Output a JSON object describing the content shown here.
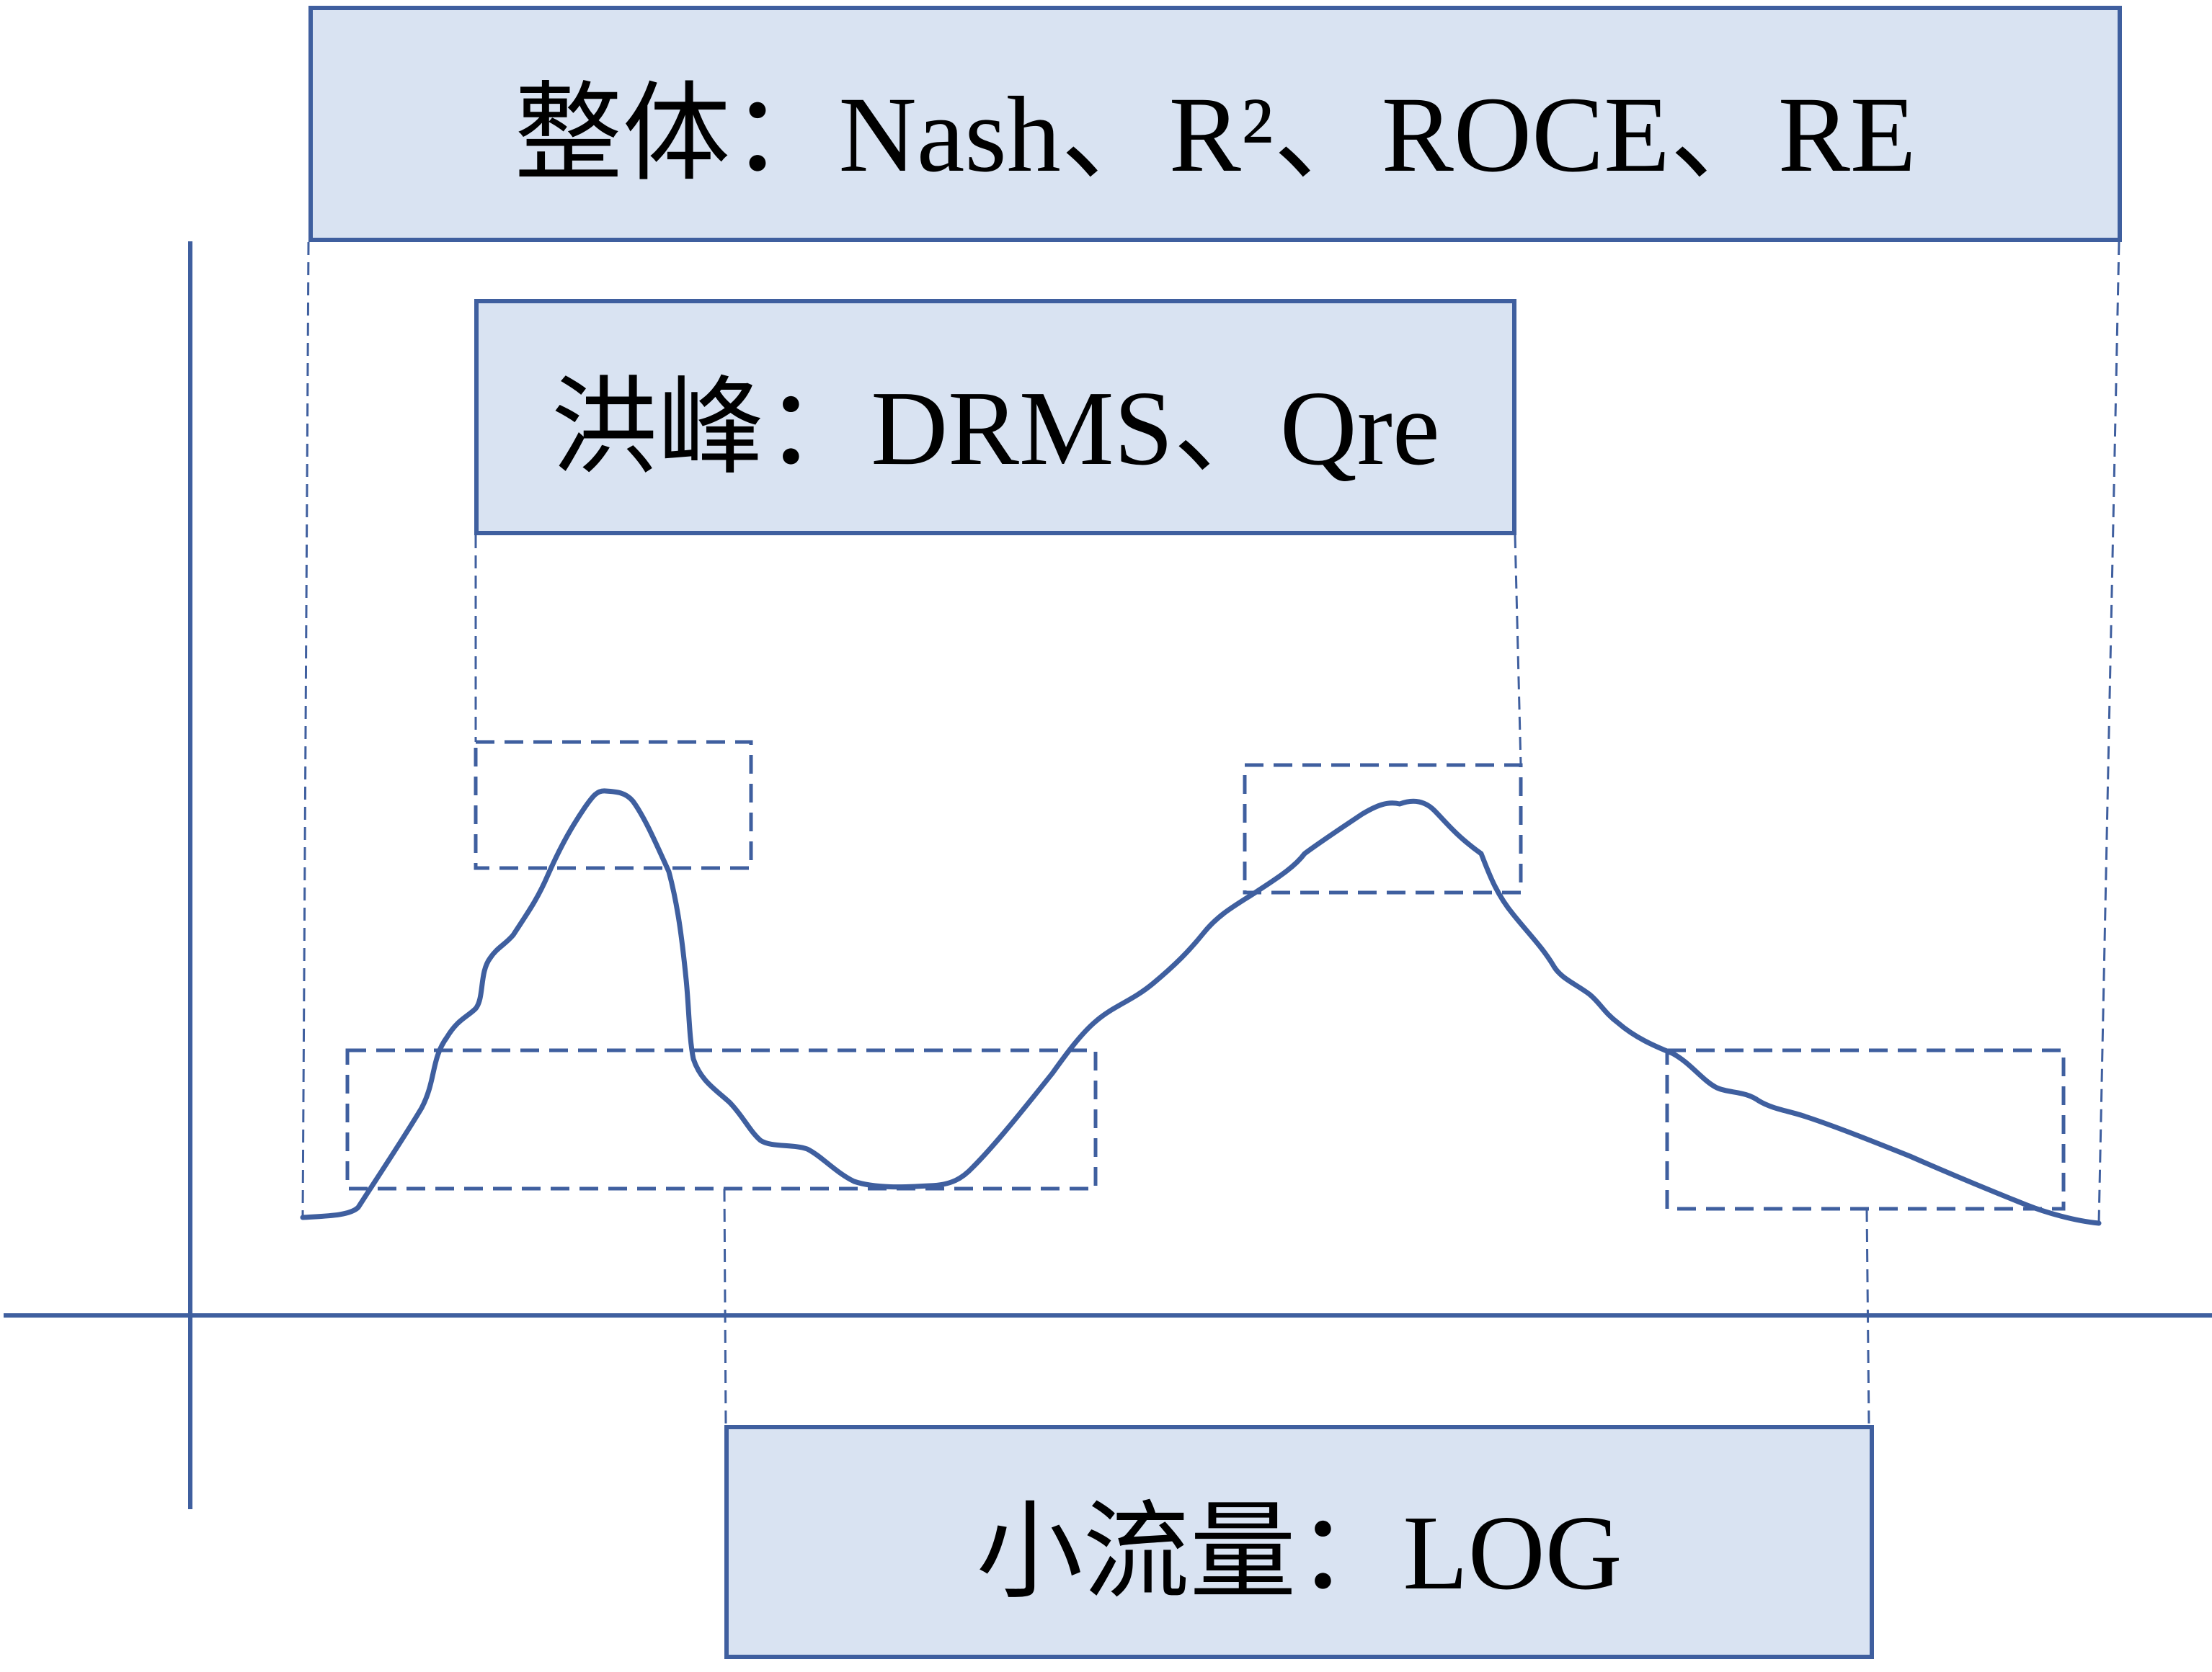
{
  "colors": {
    "line": "#3f5f9f",
    "box_fill": "#d9e3f2",
    "text": "#000000",
    "background": "#ffffff"
  },
  "labels": {
    "overall": "整体：Nash、R²、ROCE、RE",
    "peak": "洪峰：DRMS、Qre",
    "low_flow": "小流量：LOG"
  }
}
